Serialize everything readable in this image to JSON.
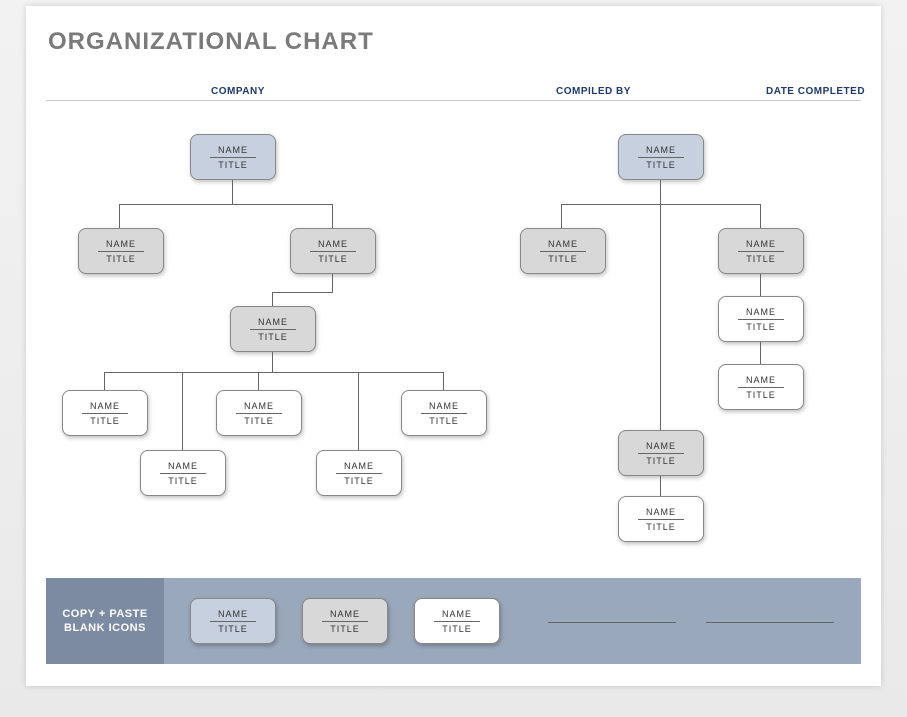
{
  "title": "ORGANIZATIONAL CHART",
  "headers": {
    "company": "COMPANY",
    "compiled": "COMPILED BY",
    "date": "DATE COMPLETED"
  },
  "labels": {
    "name": "NAME",
    "title": "TITLE"
  },
  "footer": {
    "label": "COPY + PASTE\nBLANK ICONS"
  },
  "chart_data": {
    "type": "org-chart",
    "diagrams": [
      {
        "root": {
          "name": "NAME",
          "title": "TITLE",
          "style": "blue",
          "children": [
            {
              "name": "NAME",
              "title": "TITLE",
              "style": "grey"
            },
            {
              "name": "NAME",
              "title": "TITLE",
              "style": "grey",
              "children": [
                {
                  "name": "NAME",
                  "title": "TITLE",
                  "style": "grey",
                  "children": [
                    {
                      "name": "NAME",
                      "title": "TITLE",
                      "style": "white"
                    },
                    {
                      "name": "NAME",
                      "title": "TITLE",
                      "style": "white"
                    },
                    {
                      "name": "NAME",
                      "title": "TITLE",
                      "style": "white"
                    },
                    {
                      "name": "NAME",
                      "title": "TITLE",
                      "style": "white"
                    },
                    {
                      "name": "NAME",
                      "title": "TITLE",
                      "style": "white"
                    }
                  ]
                }
              ]
            }
          ]
        }
      },
      {
        "root": {
          "name": "NAME",
          "title": "TITLE",
          "style": "blue",
          "children": [
            {
              "name": "NAME",
              "title": "TITLE",
              "style": "grey"
            },
            {
              "name": "NAME",
              "title": "TITLE",
              "style": "grey",
              "children": [
                {
                  "name": "NAME",
                  "title": "TITLE",
                  "style": "white"
                },
                {
                  "name": "NAME",
                  "title": "TITLE",
                  "style": "white",
                  "children": [
                    {
                      "name": "NAME",
                      "title": "TITLE",
                      "style": "grey",
                      "children": [
                        {
                          "name": "NAME",
                          "title": "TITLE",
                          "style": "white"
                        }
                      ]
                    }
                  ]
                }
              ]
            }
          ]
        }
      }
    ],
    "palette_samples": [
      {
        "style": "blue"
      },
      {
        "style": "grey"
      },
      {
        "style": "white"
      }
    ]
  }
}
